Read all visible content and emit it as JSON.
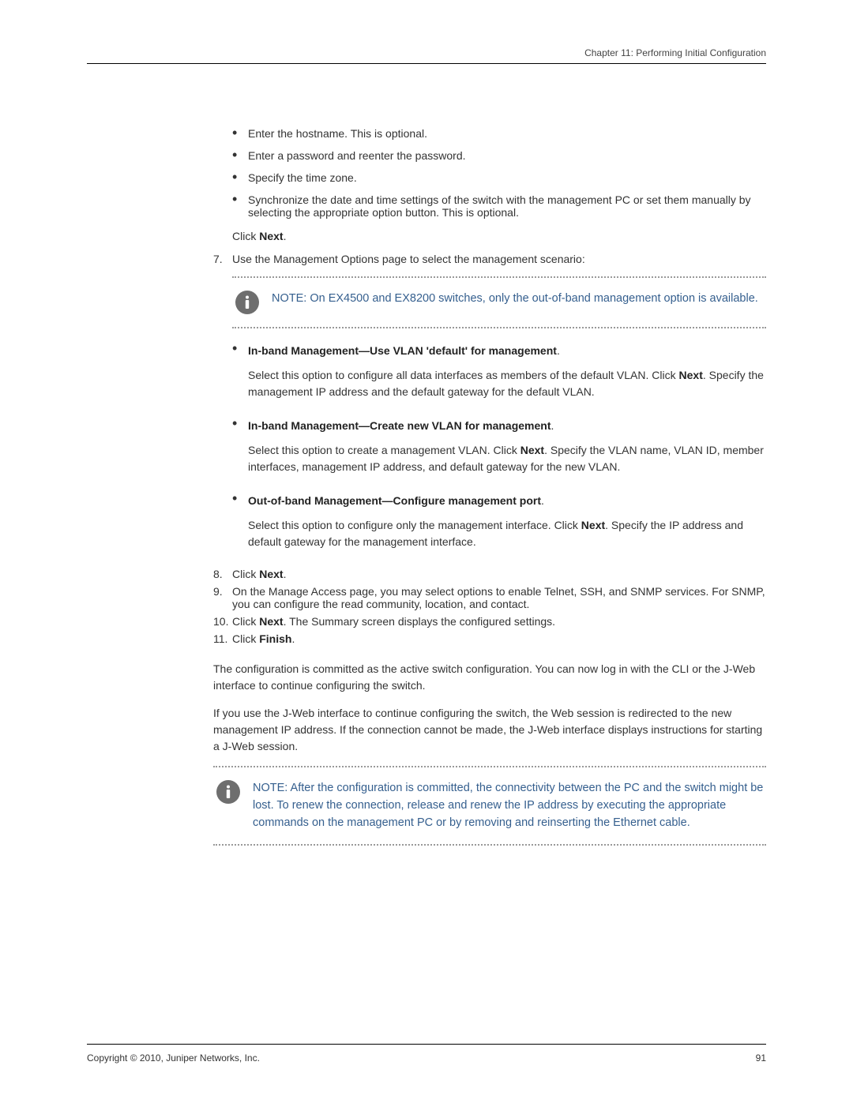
{
  "header": "Chapter 11: Performing Initial Configuration",
  "prebullets": [
    "Enter the hostname. This is optional.",
    "Enter a password and reenter the password.",
    "Specify the time zone.",
    "Synchronize the date and time settings of the switch with the management PC or set them manually by selecting the appropriate option button. This is optional."
  ],
  "click_next": {
    "pre": "Click ",
    "bold": "Next",
    "post": "."
  },
  "step7": {
    "num": "7.",
    "text": "Use the Management Options page to select the management scenario:"
  },
  "note1": "NOTE:  On EX4500 and EX8200 switches, only the out-of-band management option is available.",
  "mgmt_options": [
    {
      "title": "In-band Management—Use VLAN 'default' for management",
      "part_a": "Select this option to configure all data interfaces as members of the default VLAN. Click ",
      "bold": "Next",
      "part_b": ". Specify the management IP address and the default gateway for the default VLAN."
    },
    {
      "title": "In-band Management—Create new VLAN for management",
      "part_a": "Select this option to create a management VLAN. Click ",
      "bold": "Next",
      "part_b": ". Specify the VLAN name, VLAN ID, member interfaces, management IP address, and default gateway for the new VLAN."
    },
    {
      "title": "Out-of-band Management—Configure management port",
      "part_a": "Select this option to configure only the management interface. Click ",
      "bold": "Next",
      "part_b": ". Specify the IP address and default gateway for the management interface."
    }
  ],
  "step8": {
    "num": "8.",
    "pre": "Click ",
    "bold": "Next",
    "post": "."
  },
  "step9": {
    "num": "9.",
    "text": "On the Manage Access page, you may select options to enable Telnet, SSH, and SNMP services. For SNMP, you can configure the read community, location, and contact."
  },
  "step10": {
    "num": "10.",
    "pre": "Click ",
    "bold": "Next",
    "post": ". The Summary screen displays the configured settings."
  },
  "step11": {
    "num": "11.",
    "pre": "Click ",
    "bold": "Finish",
    "post": "."
  },
  "para1": "The configuration is committed as the active switch configuration. You can now log in with the CLI or the J-Web interface to continue configuring the switch.",
  "para2": "If you use the J-Web interface to continue configuring the switch, the Web session is redirected to the new management IP address. If the connection cannot be made, the J-Web interface displays instructions for starting a J-Web session.",
  "note2": "NOTE:  After the configuration is committed, the connectivity between the PC and the switch might be lost. To renew the connection, release and renew the IP address by executing the appropriate commands on the management PC or by removing and reinserting the Ethernet cable.",
  "footer_left": "Copyright © 2010, Juniper Networks, Inc.",
  "footer_right": "91"
}
